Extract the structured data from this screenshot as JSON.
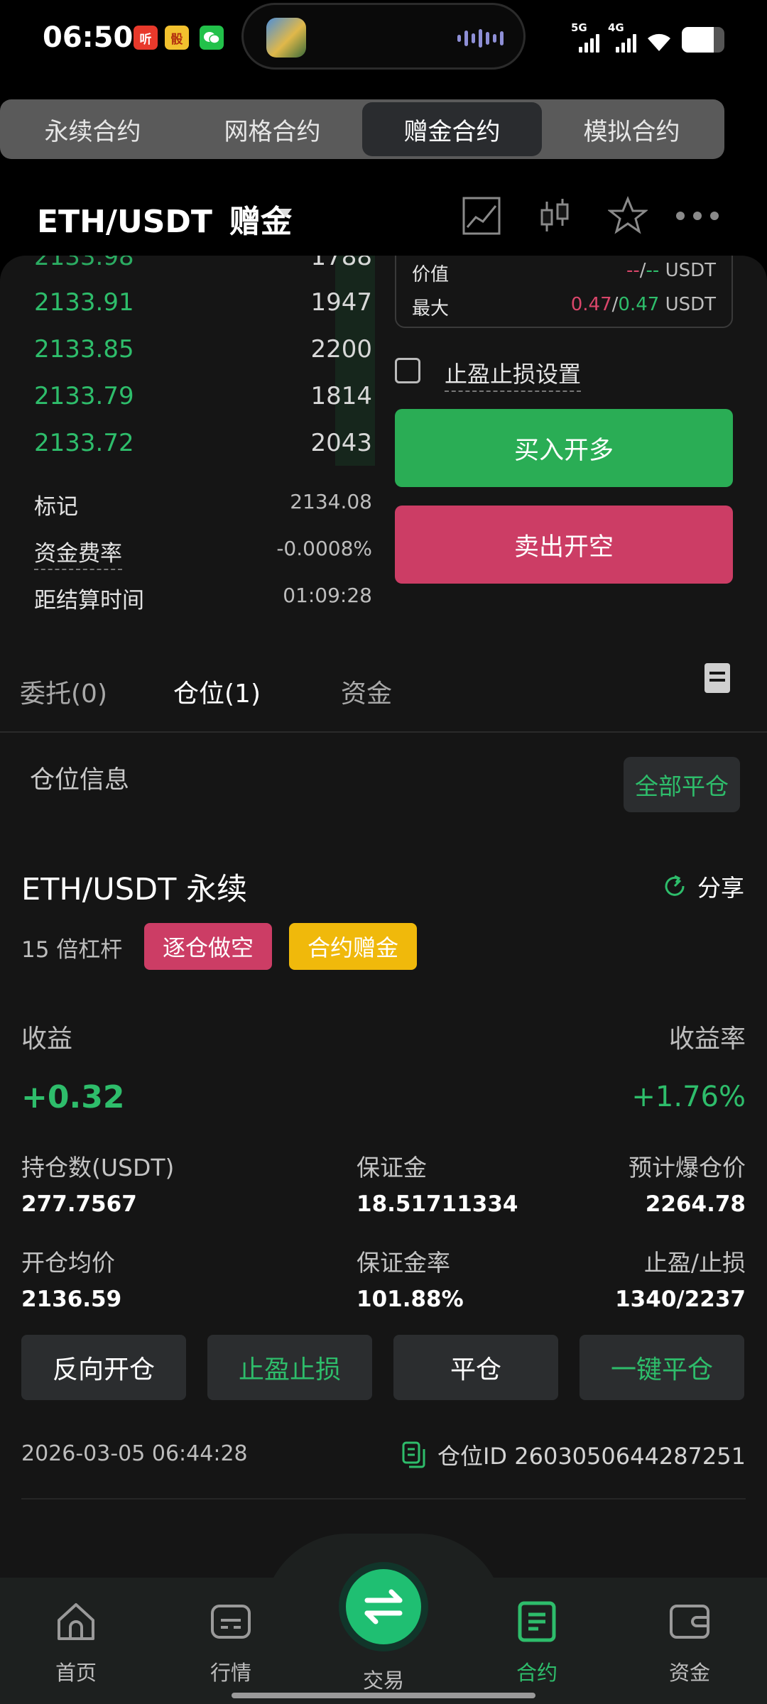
{
  "status_bar": {
    "time": "06:50",
    "app_icons": [
      {
        "name": "ting-app-icon",
        "text": "听",
        "color": "#e8392b"
      },
      {
        "name": "game-app-icon",
        "text": "骰",
        "color": "#f2c12e"
      },
      {
        "name": "wechat-icon",
        "text": "",
        "color": "#22c14a"
      }
    ],
    "signal1_label": "5G",
    "signal2_label": "4G",
    "battery_level": 0.75
  },
  "top_tabs": [
    {
      "label": "永续合约",
      "active": false
    },
    {
      "label": "网格合约",
      "active": false
    },
    {
      "label": "赠金合约",
      "active": true
    },
    {
      "label": "模拟合约",
      "active": false
    }
  ],
  "header": {
    "pair": "ETH/USDT",
    "tag": "赠金"
  },
  "orderbook": {
    "rows": [
      {
        "price": "2133.91",
        "qty": "1947"
      },
      {
        "price": "2133.85",
        "qty": "2200"
      },
      {
        "price": "2133.79",
        "qty": "1814"
      },
      {
        "price": "2133.72",
        "qty": "2043"
      }
    ],
    "mark_label": "标记",
    "mark_value": "2134.08",
    "funding_label": "资金费率",
    "funding_value": "-0.0008%",
    "settle_label": "距结算时间",
    "settle_value": "01:09:28"
  },
  "trade_box": {
    "value_label": "价值",
    "value_a": "--",
    "value_b": "--",
    "value_unit": "USDT",
    "max_label": "最大",
    "max_a": "0.47",
    "max_b": "0.47",
    "max_unit": "USDT"
  },
  "tpsl_setting_label": "止盈止损设置",
  "buy_label": "买入开多",
  "sell_label": "卖出开空",
  "bottom_tabs": [
    {
      "label": "委托(0)",
      "active": false
    },
    {
      "label": "仓位(1)",
      "active": true
    },
    {
      "label": "资金",
      "active": false
    }
  ],
  "position": {
    "section_title": "仓位信息",
    "close_all_label": "全部平仓",
    "symbol": "ETH/USDT 永续",
    "share_label": "分享",
    "leverage": "15 倍杠杆",
    "side_badge": "逐仓做空",
    "bonus_badge": "合约赠金",
    "pnl_label": "收益",
    "roe_label": "收益率",
    "pnl_value": "+0.32",
    "roe_value": "+1.76%",
    "stats": {
      "size_label": "持仓数(USDT)",
      "size_value": "277.7567",
      "margin_label": "保证金",
      "margin_value": "18.51711334",
      "liq_label": "预计爆仓价",
      "liq_value": "2264.78",
      "entry_label": "开仓均价",
      "entry_value": "2136.59",
      "margin_ratio_label": "保证金率",
      "margin_ratio_value": "101.88%",
      "tpsl_label": "止盈/止损",
      "tpsl_value": "1340/2237"
    },
    "actions": [
      "反向开仓",
      "止盈止损",
      "平仓",
      "一键平仓"
    ],
    "open_time": "2026-03-05 06:44:28",
    "position_id": "仓位ID 2603050644287251"
  },
  "bottom_nav": {
    "home": "首页",
    "market": "行情",
    "trade": "交易",
    "contract": "合约",
    "assets": "资金"
  },
  "colors": {
    "green": "#2ebd6b",
    "red": "#cc3d65",
    "yellow": "#f0b90b",
    "background": "#151515"
  }
}
